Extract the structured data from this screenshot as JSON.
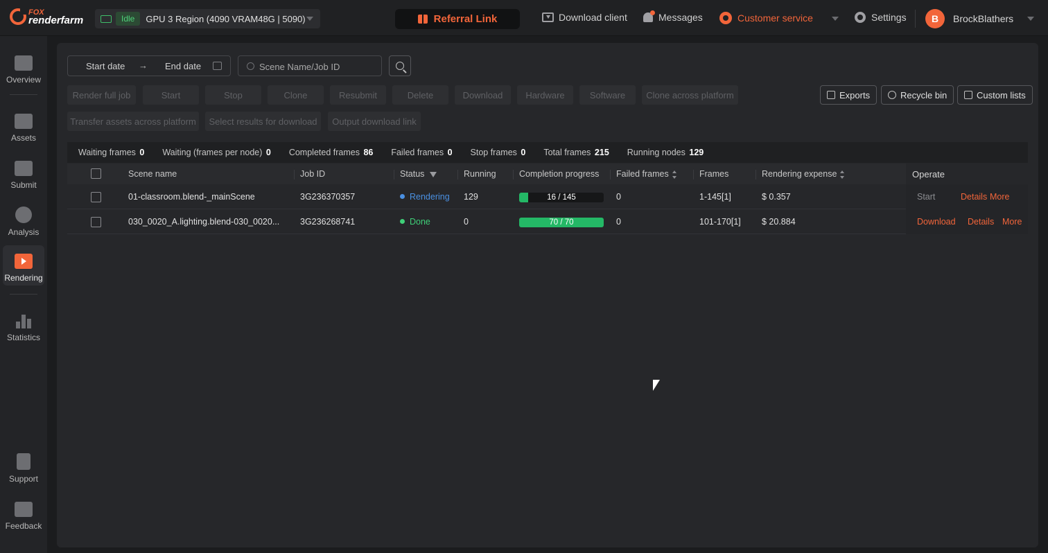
{
  "brand": {
    "line1": "FOX",
    "line2": "renderfarm"
  },
  "region": {
    "status": "Idle",
    "name": "GPU 3 Region  (4090 VRAM48G | 5090)"
  },
  "topnav": {
    "referral": "Referral Link",
    "download_client": "Download client",
    "messages": "Messages",
    "customer_service": "Customer service",
    "settings": "Settings",
    "avatar_letter": "B",
    "username": "BrockBlathers"
  },
  "sidebar": {
    "items": [
      {
        "label": "Overview"
      },
      {
        "label": "Assets"
      },
      {
        "label": "Submit"
      },
      {
        "label": "Analysis"
      },
      {
        "label": "Rendering"
      },
      {
        "label": "Statistics"
      },
      {
        "label": "Support"
      },
      {
        "label": "Feedback"
      }
    ]
  },
  "filters": {
    "start_date": "Start date",
    "arrow": "→",
    "end_date": "End date",
    "search_placeholder": "Scene Name/Job ID"
  },
  "actions": [
    "Render full job",
    "Start",
    "Stop",
    "Clone",
    "Resubmit",
    "Delete",
    "Download",
    "Hardware",
    "Software",
    "Clone across platform",
    "Transfer assets across platform",
    "Select results for download",
    "Output download link"
  ],
  "right_actions": {
    "exports": "Exports",
    "recycle_bin": "Recycle bin",
    "custom_lists": "Custom lists"
  },
  "stats": {
    "waiting_frames_label": "Waiting frames",
    "waiting_frames": "0",
    "waiting_per_node_label": "Waiting (frames per node)",
    "waiting_per_node": "0",
    "completed_label": "Completed frames",
    "completed": "86",
    "failed_label": "Failed frames",
    "failed": "0",
    "stop_label": "Stop frames",
    "stop": "0",
    "total_label": "Total frames",
    "total": "215",
    "running_nodes_label": "Running nodes",
    "running_nodes": "129"
  },
  "table": {
    "headers": {
      "scene": "Scene name",
      "job_id": "Job ID",
      "status": "Status",
      "running": "Running",
      "progress": "Completion progress",
      "failed": "Failed frames",
      "frames": "Frames",
      "expense": "Rendering expense",
      "operate": "Operate"
    },
    "rows": [
      {
        "scene": "01-classroom.blend-_mainScene",
        "job_id": "3G236370357",
        "status": "Rendering",
        "status_color": "#4a90e2",
        "running": "129",
        "progress_text": "16 / 145",
        "progress_fraction": 0.11,
        "failed": "0",
        "frames": "1-145[1]",
        "expense": "$ 0.357",
        "op1": "Start",
        "op2": "Details",
        "op3": "More"
      },
      {
        "scene": "030_0020_A.lighting.blend-030_0020...",
        "job_id": "3G236268741",
        "status": "Done",
        "status_color": "#3fcf78",
        "running": "0",
        "progress_text": "70 / 70",
        "progress_fraction": 1.0,
        "failed": "0",
        "frames": "101-170[1]",
        "expense": "$ 20.884",
        "op1": "Download",
        "op2": "Details",
        "op3": "More"
      }
    ]
  }
}
